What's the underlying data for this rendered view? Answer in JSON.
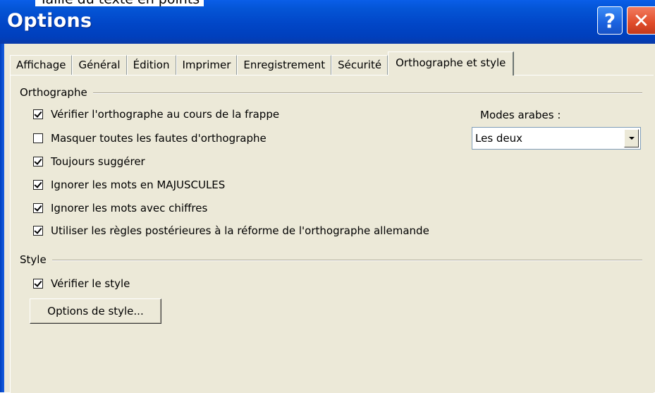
{
  "window": {
    "title": "Options",
    "cropped_top_text": "Taille du texte en points",
    "help_label": "?",
    "close_label": "✕"
  },
  "tabs": [
    {
      "label": "Affichage",
      "active": false
    },
    {
      "label": "Général",
      "active": false
    },
    {
      "label": "Édition",
      "active": false
    },
    {
      "label": "Imprimer",
      "active": false
    },
    {
      "label": "Enregistrement",
      "active": false
    },
    {
      "label": "Sécurité",
      "active": false
    },
    {
      "label": "Orthographe et style",
      "active": true
    }
  ],
  "orthographe": {
    "group_label": "Orthographe",
    "options": [
      {
        "label": "Vérifier l'orthographe au cours de la frappe",
        "checked": true
      },
      {
        "label": "Masquer toutes les fautes d'orthographe",
        "checked": false
      },
      {
        "label": "Toujours suggérer",
        "checked": true
      },
      {
        "label": "Ignorer les mots en MAJUSCULES",
        "checked": true
      },
      {
        "label": "Ignorer les mots avec chiffres",
        "checked": true
      },
      {
        "label": "Utiliser les règles postérieures à la réforme de l'orthographe allemande",
        "checked": true
      }
    ],
    "modes_arabes_label": "Modes arabes :",
    "modes_arabes_value": "Les deux"
  },
  "style": {
    "group_label": "Style",
    "verify_label": "Vérifier le style",
    "verify_checked": true,
    "options_button": "Options de style..."
  },
  "colors": {
    "titlebar": "#0146c7",
    "close_button": "#e04c2a",
    "dialog_background": "#ece9d8"
  }
}
